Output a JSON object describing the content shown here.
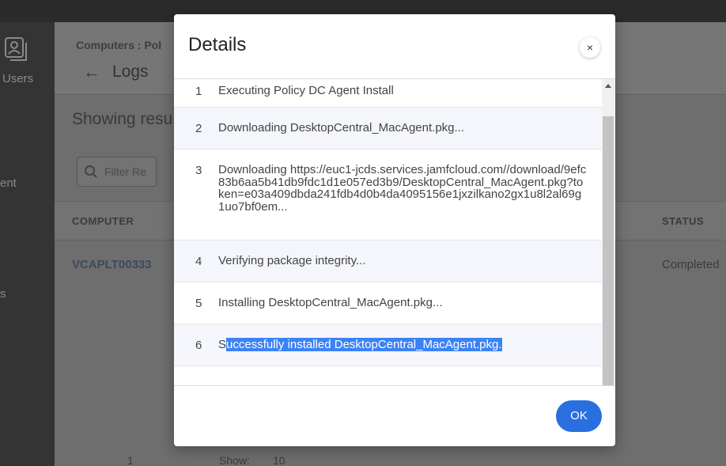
{
  "sidebar": {
    "items": [
      {
        "label": "Users",
        "icon": "users-icon"
      },
      {
        "label": "ent"
      },
      {
        "label": "s"
      }
    ]
  },
  "header": {
    "breadcrumb": "Computers  :  Pol",
    "back_icon": "left-arrow-icon",
    "title": "Logs"
  },
  "main": {
    "showing_text": "Showing resu",
    "filter_placeholder": "Filter Re",
    "columns": [
      "COMPUTER",
      "STATUS"
    ],
    "rows": [
      {
        "computer": "VCAPLT00333",
        "status": "Completed"
      }
    ],
    "pager": {
      "page": "1",
      "show_label": "Show:",
      "show_value": "10"
    }
  },
  "modal": {
    "title": "Details",
    "close_label": "×",
    "logs": [
      {
        "num": "1",
        "text": "Executing Policy DC Agent Install"
      },
      {
        "num": "2",
        "text": "Downloading DesktopCentral_MacAgent.pkg..."
      },
      {
        "num": "3",
        "text": "Downloading https://euc1-jcds.services.jamfcloud.com//download/9efc83b6aa5b41db9fdc1d1e057ed3b9/DesktopCentral_MacAgent.pkg?token=e03a409dbda241fdb4d0b4da4095156e1jxzilkano2gx1u8l2al69g1uo7bf0em..."
      },
      {
        "num": "4",
        "text": "Verifying package integrity..."
      },
      {
        "num": "5",
        "text": "Installing DesktopCentral_MacAgent.pkg..."
      },
      {
        "num": "6",
        "text_prefix": "S",
        "text_selected": "uccessfully installed DesktopCentral_MacAgent.pkg."
      }
    ],
    "ok_label": "OK"
  },
  "colors": {
    "accent": "#2a6fe0",
    "selection": "#3b82f6",
    "overlay": "#6e6e6e"
  }
}
